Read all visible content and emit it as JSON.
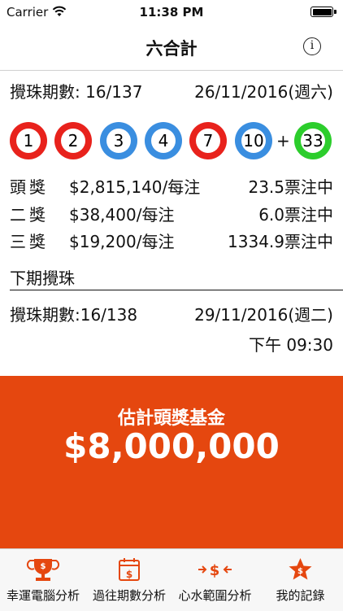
{
  "status": {
    "carrier": "Carrier",
    "time": "11:38 PM"
  },
  "nav": {
    "title": "六合計",
    "info_icon": "info-icon"
  },
  "draw": {
    "label": "攪珠期數: 16/137",
    "date": "26/11/2016(週六)",
    "balls": [
      {
        "num": "1",
        "color": "#e8221c"
      },
      {
        "num": "2",
        "color": "#e8221c"
      },
      {
        "num": "3",
        "color": "#3a8ee0"
      },
      {
        "num": "4",
        "color": "#3a8ee0"
      },
      {
        "num": "7",
        "color": "#e8221c"
      },
      {
        "num": "10",
        "color": "#3a8ee0"
      }
    ],
    "plus": "+",
    "special": {
      "num": "33",
      "color": "#2ccd2c"
    }
  },
  "prizes": [
    {
      "name": "頭獎",
      "amount": "$2,815,140/每注",
      "odds": "23.5票注中"
    },
    {
      "name": "二獎",
      "amount": "$38,400/每注",
      "odds": "6.0票注中"
    },
    {
      "name": "三獎",
      "amount": "$19,200/每注",
      "odds": "1334.9票注中"
    }
  ],
  "next": {
    "section_title": "下期攪珠",
    "label": "攪珠期數:16/138",
    "date": "29/11/2016(週二)",
    "time": "下午 09:30"
  },
  "jackpot": {
    "label": "估計頭獎基金",
    "amount": "$8,000,000",
    "color": "#e5470f"
  },
  "tabs": [
    {
      "label": "幸運電腦分析",
      "icon": "trophy-dollar-icon"
    },
    {
      "label": "過往期數分析",
      "icon": "calendar-dollar-icon"
    },
    {
      "label": "心水範圍分析",
      "icon": "dollar-range-icon"
    },
    {
      "label": "我的記錄",
      "icon": "star-dollar-icon"
    }
  ],
  "accent": "#e5470f"
}
